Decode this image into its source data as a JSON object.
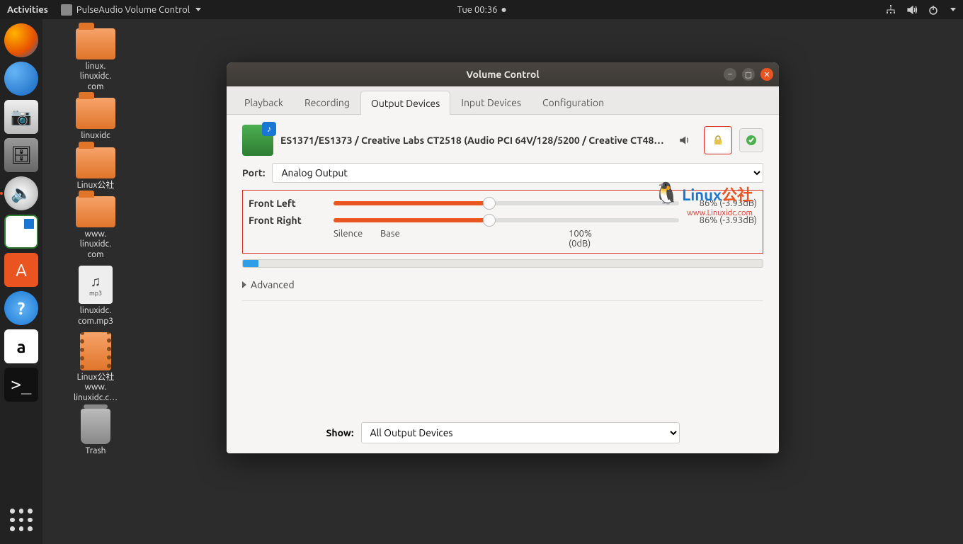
{
  "topbar": {
    "activities": "Activities",
    "app_name": "PulseAudio Volume Control",
    "clock": "Tue 00:36"
  },
  "desktop_icons": [
    {
      "type": "folder",
      "label": "linux.\nlinuxidc.\ncom"
    },
    {
      "type": "folder",
      "label": "linuxidc"
    },
    {
      "type": "folder",
      "label": "Linux公社"
    },
    {
      "type": "folder",
      "label": "www.\nlinuxidc.\ncom"
    },
    {
      "type": "mp3",
      "label": "linuxidc.\ncom.mp3"
    },
    {
      "type": "video",
      "label": "Linux公社\nwww.\nlinuxidc.c…"
    },
    {
      "type": "trash",
      "label": "Trash"
    }
  ],
  "window": {
    "title": "Volume Control",
    "tabs": [
      "Playback",
      "Recording",
      "Output Devices",
      "Input Devices",
      "Configuration"
    ],
    "active_tab": 2,
    "device_name": "ES1371/ES1373 / Creative Labs CT2518 (Audio PCI 64V/128/5200 / Creative CT481…",
    "port_label": "Port:",
    "port_value": "Analog Output",
    "channels": [
      {
        "name": "Front Left",
        "pct": 45,
        "readout": "86% (-3.93dB)"
      },
      {
        "name": "Front Right",
        "pct": 45,
        "readout": "86% (-3.93dB)"
      }
    ],
    "ticks": {
      "silence": "Silence",
      "base": "Base",
      "hundred": "100% (0dB)"
    },
    "advanced": "Advanced",
    "show_label": "Show:",
    "show_value": "All Output Devices"
  },
  "watermark": {
    "line1a": "Linux",
    "line1b": "公社",
    "line2": "www.Linuxidc.com"
  }
}
